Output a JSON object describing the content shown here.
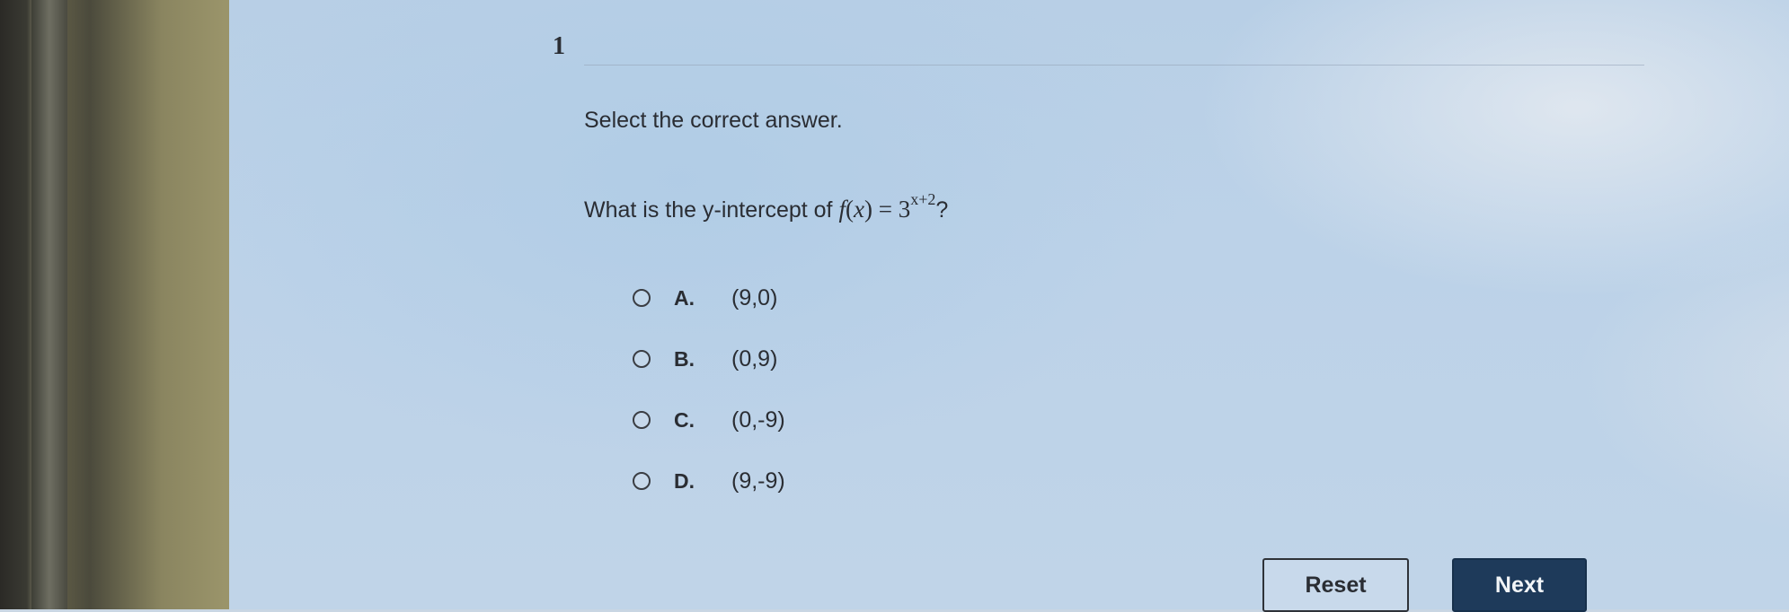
{
  "question": {
    "number": "1",
    "instruction": "Select the correct answer.",
    "prompt_prefix": "What is the y-intercept of ",
    "function_name": "f",
    "function_var": "x",
    "equals": " = ",
    "base": "3",
    "exponent": "x+2",
    "prompt_suffix": "?"
  },
  "options": [
    {
      "letter": "A.",
      "value": "(9,0)"
    },
    {
      "letter": "B.",
      "value": "(0,9)"
    },
    {
      "letter": "C.",
      "value": "(0,-9)"
    },
    {
      "letter": "D.",
      "value": "(9,-9)"
    }
  ],
  "buttons": {
    "reset_label": "Reset",
    "next_label": "Next"
  },
  "colors": {
    "next_button": "#1e3a5a",
    "screen_background": "#bcd2e8"
  }
}
